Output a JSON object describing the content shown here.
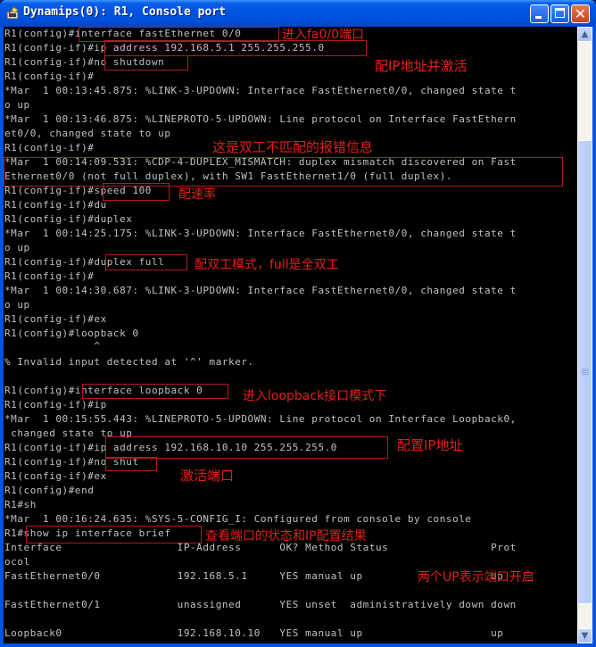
{
  "window": {
    "title": "Dynamips(0): R1, Console port",
    "icon": "terminal-plug-icon",
    "controls": {
      "minimize": "minimize-icon",
      "maximize": "maximize-icon",
      "close": "close-icon"
    },
    "colors": {
      "titlebar": "#0054e3",
      "console_bg": "#000000",
      "console_text": "#c0c0c0",
      "annotation": "#e0201a",
      "highlight_box": "#b21b1b"
    }
  },
  "console": {
    "lines": [
      "R1(config)#interface fastEthernet 0/0",
      "R1(config-if)#ip address 192.168.5.1 255.255.255.0",
      "R1(config-if)#no shutdown",
      "R1(config-if)#",
      "*Mar  1 00:13:45.875: %LINK-3-UPDOWN: Interface FastEthernet0/0, changed state t",
      "o up",
      "*Mar  1 00:13:46.875: %LINEPROTO-5-UPDOWN: Line protocol on Interface FastEthern",
      "et0/0, changed state to up",
      "R1(config-if)#",
      "*Mar  1 00:14:09.531: %CDP-4-DUPLEX_MISMATCH: duplex mismatch discovered on Fast",
      "Ethernet0/0 (not full duplex), with SW1 FastEthernet1/0 (full duplex).",
      "R1(config-if)#speed 100",
      "R1(config-if)#du",
      "R1(config-if)#duplex",
      "*Mar  1 00:14:25.175: %LINK-3-UPDOWN: Interface FastEthernet0/0, changed state t",
      "o up",
      "R1(config-if)#duplex full",
      "R1(config-if)#",
      "*Mar  1 00:14:30.687: %LINK-3-UPDOWN: Interface FastEthernet0/0, changed state t",
      "o up",
      "R1(config-if)#ex",
      "R1(config)#loopback 0",
      "              ^",
      "% Invalid input detected at '^' marker.",
      "",
      "R1(config)#interface loopback 0",
      "R1(config-if)#ip",
      "*Mar  1 00:15:55.443: %LINEPROTO-5-UPDOWN: Line protocol on Interface Loopback0,",
      " changed state to up",
      "R1(config-if)#ip address 192.168.10.10 255.255.255.0",
      "R1(config-if)#no shut",
      "R1(config-if)#ex",
      "R1(config)#end",
      "R1#sh",
      "*Mar  1 00:16:24.635: %SYS-5-CONFIG_I: Configured from console by console",
      "R1#show ip interface brief",
      "Interface                  IP-Address      OK? Method Status                Prot",
      "ocol",
      "FastEthernet0/0            192.168.5.1     YES manual up                    up",
      "",
      "FastEthernet0/1            unassigned      YES unset  administratively down down",
      "",
      "Loopback0                  192.168.10.10   YES manual up                    up"
    ],
    "annotations": [
      "进入fa0/0端口",
      "配IP地址并激活",
      "这是双工不匹配的报错信息",
      "配速率",
      "配双工模式，full是全双工",
      "进入loopback接口模式下",
      "配置IP地址",
      "激活端口",
      "查看端口的状态和IP配置结果",
      "两个UP表示端口开启"
    ]
  },
  "scrollbar": {
    "up": "scroll-up-arrow-icon",
    "down": "scroll-down-arrow-icon",
    "position_fraction": 0.95
  }
}
